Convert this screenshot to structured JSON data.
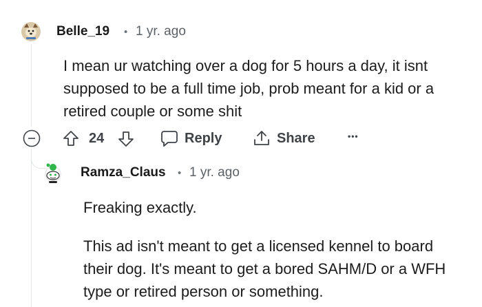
{
  "comments": [
    {
      "username": "Belle_19",
      "separator": "•",
      "timestamp": "1 yr. ago",
      "text": "I mean ur watching over a dog for 5 hours a day, it isnt supposed to be a full time job, prob meant for a kid or a retired couple or some shit",
      "vote_count": "24",
      "reply_label": "Reply",
      "share_label": "Share",
      "more_label": "•••"
    },
    {
      "username": "Ramza_Claus",
      "separator": "•",
      "timestamp": "1 yr. ago",
      "paragraph_1": "Freaking exactly.",
      "paragraph_2": "This ad isn't meant to get a licensed kennel to board their dog. It's meant to get a bored SAHM/D or a WFH type or retired person or something."
    }
  ],
  "icons": {
    "avatar_1": "dog-avatar-icon",
    "avatar_2": "snoo-avatar-icon",
    "collapse": "collapse-minus-icon",
    "upvote": "arrow-up-icon",
    "downvote": "arrow-down-icon",
    "reply": "chat-bubble-icon",
    "share": "share-icon"
  }
}
